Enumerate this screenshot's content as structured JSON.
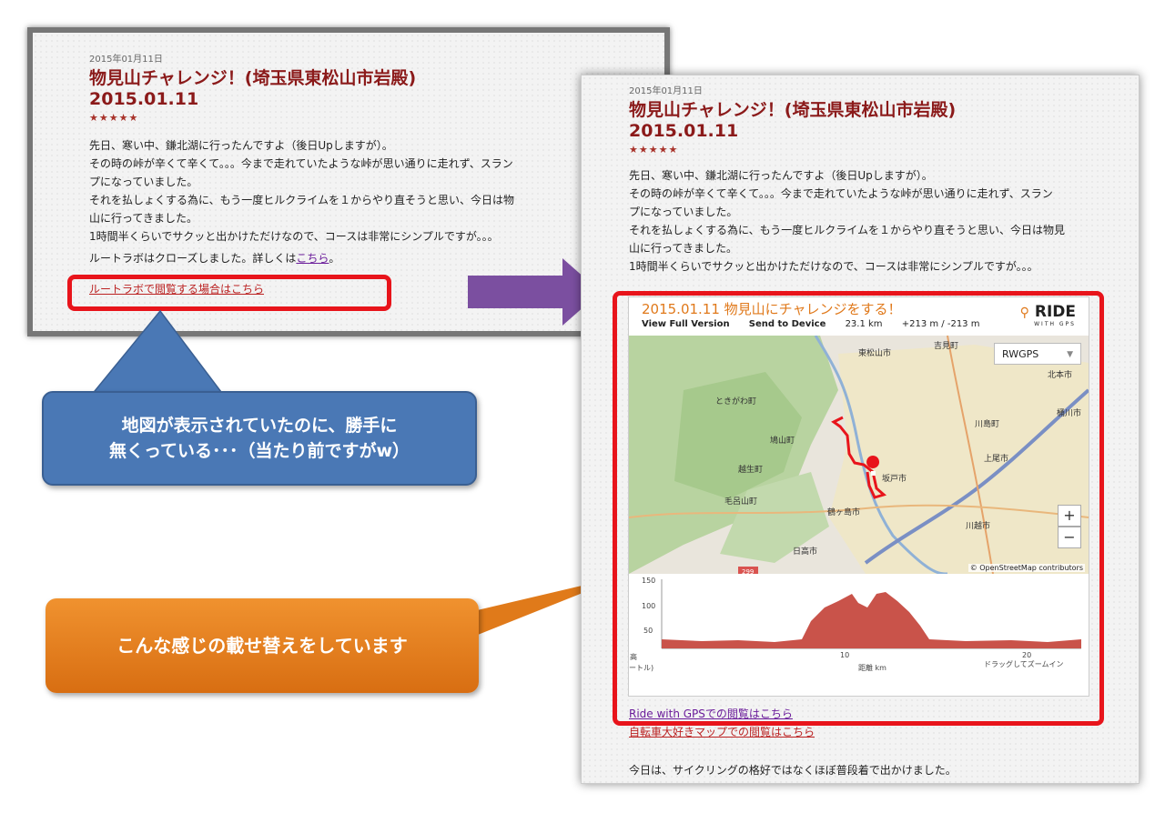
{
  "before": {
    "date": "2015年01月11日",
    "title_line1": "物見山チャレンジ！(埼玉県東松山市岩殿)",
    "title_line2": "2015.01.11",
    "stars": "★★★★★",
    "paragraphs": [
      "先日、寒い中、鎌北湖に行ったんですよ（後日Upしますが）。",
      "その時の峠が辛くて辛くて。。。今まで走れていたような峠が思い通りに走れず、スラン",
      "プになっていました。",
      "それを払しょくする為に、もう一度ヒルクライムを１からやり直そうと思い、今日は物",
      "山に行ってきました。",
      "1時間半くらいでサクッと出かけただけなので、コースは非常にシンプルですが。。。"
    ],
    "closed_text": "ルートラボはクローズしました。詳しくは",
    "closed_link": "こちら",
    "closed_end": "。",
    "partial_link": "ルートラボで閲覧する場合はこちら"
  },
  "after": {
    "date": "2015年01月11日",
    "title_line1": "物見山チャレンジ！(埼玉県東松山市岩殿)",
    "title_line2": "2015.01.11",
    "stars": "★★★★★",
    "paragraphs": [
      "先日、寒い中、鎌北湖に行ったんですよ（後日Upしますが）。",
      "その時の峠が辛くて辛くて。。。今まで走れていたような峠が思い通りに走れず、スラン",
      "プになっていました。",
      "それを払しょくする為に、もう一度ヒルクライムを１からやり直そうと思い、今日は物見",
      "山に行ってきました。",
      "1時間半くらいでサクッと出かけただけなので、コースは非常にシンプルですが。。。"
    ],
    "widget": {
      "title": "2015.01.11 物見山にチャレンジをする！",
      "view_full": "View Full Version",
      "send_device": "Send to Device",
      "distance": "23.1 km",
      "elevation": "+213 m / -213 m",
      "logo": "RIDE",
      "logo_sub": "WITH GPS",
      "map_select": "RWGPS",
      "zoom_in": "+",
      "zoom_out": "−",
      "attribution": "© OpenStreetMap contributors",
      "places": [
        "東松山市",
        "吉見町",
        "北本市",
        "桶川市",
        "ときがわ町",
        "鳩山町",
        "越生町",
        "毛呂山町",
        "坂戸市",
        "鶴ヶ島市",
        "川島町",
        "日高市",
        "川越市",
        "上尾市"
      ],
      "road_number": "299",
      "elev_yticks": [
        "150",
        "100",
        "50"
      ],
      "elev_xticks": [
        "10",
        "20"
      ],
      "elev_xlabel": "距離 km",
      "elev_ylabel_top": "高",
      "elev_ylabel_bottom": "ートル)",
      "drag_hint": "ドラッグしてズームイン"
    },
    "link_rwgps": "Ride with GPSでの閲覧はこちら",
    "link_bike_map": "自転車大好きマップでの閲覧はこちら",
    "footer_text": "今日は、サイクリングの格好ではなくほぼ普段着で出かけました。"
  },
  "callout_blue": {
    "line1": "地図が表示されていたのに、勝手に",
    "line2": "無くっている･･･（当たり前ですがw）",
    "color": "#4a78b5"
  },
  "callout_orange": {
    "text": "こんな感じの載せ替えをしています",
    "color": "#e07a1a"
  },
  "arrow_color": "#7b4fa0",
  "highlight_color": "#e8141b"
}
